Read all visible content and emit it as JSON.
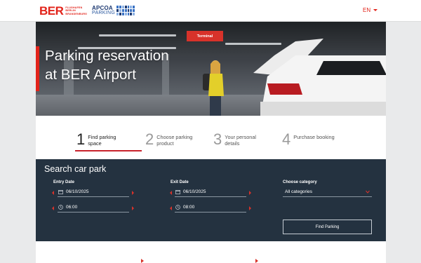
{
  "header": {
    "ber_logo_text": "BER",
    "ber_logo_sub": [
      "FLUGHAFEN",
      "BERLIN",
      "BRANDENBURG"
    ],
    "apcoa_logo_top": "APCOA",
    "apcoa_logo_bottom": "PARKING",
    "language": "EN"
  },
  "hero": {
    "headline_line1": "Parking reservation",
    "headline_line2": "at BER Airport",
    "sign_text": "Terminal"
  },
  "steps": [
    {
      "number": "1",
      "label": "Find parking space",
      "active": true
    },
    {
      "number": "2",
      "label": "Choose parking product",
      "active": false
    },
    {
      "number": "3",
      "label": "Your personal details",
      "active": false
    },
    {
      "number": "4",
      "label": "Purchase booking",
      "active": false
    }
  ],
  "search": {
    "title": "Search car park",
    "entry_label": "Entry Date",
    "entry_date": "06/10/2025",
    "entry_time": "06:00",
    "exit_label": "Exit Date",
    "exit_date": "06/10/2025",
    "exit_time": "08:00",
    "category_label": "Choose category",
    "category_value": "All categories",
    "find_button": "Find Parking"
  },
  "colors": {
    "accent_red": "#e2231a",
    "search_bg": "#243240",
    "apcoa_blue": "#1e3a72"
  }
}
